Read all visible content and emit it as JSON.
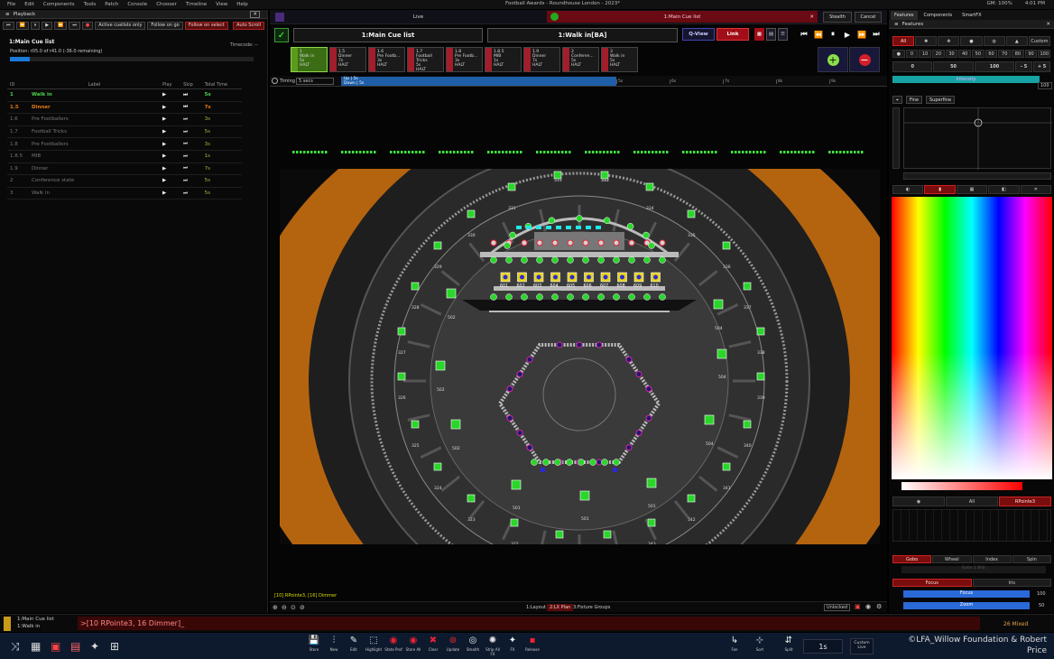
{
  "menu": {
    "items": [
      "File",
      "Edit",
      "Components",
      "Tools",
      "Patch",
      "Console",
      "Chooser",
      "Timeline",
      "View",
      "Help"
    ],
    "title": "Football Awards - Roundhouse London - 2023*",
    "gm": "GM: 100%",
    "time": "4:01 PM"
  },
  "playback": {
    "panel_title": "Playback",
    "buttons": {
      "active": "Active cuelists only",
      "follow_go": "Follow on go",
      "follow_select": "Follow on select",
      "auto_scroll": "Auto Scroll"
    },
    "cuelist_name": "1:Main Cue list",
    "timecode": "Timecode: --",
    "position": "Position: r05.0 of r41.0 (-36.0 remaining)",
    "progress": 0.08,
    "columns": [
      "ID",
      "Label",
      "Play",
      "Skip",
      "Total Time"
    ],
    "cues": [
      {
        "id": "1",
        "label": "Walk in",
        "time": "5s",
        "state": "active"
      },
      {
        "id": "1.5",
        "label": "Dinner",
        "time": "7s",
        "state": "next"
      },
      {
        "id": "1.6",
        "label": "Pre Footballers",
        "time": "3s",
        "state": ""
      },
      {
        "id": "1.7",
        "label": "Football Tricks",
        "time": "5s",
        "state": ""
      },
      {
        "id": "1.8",
        "label": "Pre Footballers",
        "time": "3s",
        "state": ""
      },
      {
        "id": "1.8.5",
        "label": "MIB",
        "time": "1s",
        "state": ""
      },
      {
        "id": "1.9",
        "label": "Dinner",
        "time": "7s",
        "state": ""
      },
      {
        "id": "2",
        "label": "Conference state",
        "time": "5s",
        "state": ""
      },
      {
        "id": "3",
        "label": "Walk in",
        "time": "5s",
        "state": ""
      }
    ]
  },
  "center": {
    "live": "Live",
    "current_cuelist": "1:Main Cue list",
    "stealth": "Stealth",
    "cancel": "Cancel",
    "cuelist_box": "1:Main Cue list",
    "walkin_box": "1:Walk in[BA]",
    "qview": "Q-View",
    "link": "Link",
    "tiles": [
      {
        "n": "1",
        "l": "Walk in",
        "t": "5s",
        "h": "HALT"
      },
      {
        "n": "1.5",
        "l": "Dinner",
        "t": "7s",
        "h": "HALT"
      },
      {
        "n": "1.6",
        "l": "Pre Footb...",
        "t": "3s",
        "h": "HALT"
      },
      {
        "n": "1.7",
        "l": "Football Tricks",
        "t": "5s",
        "h": "HALT"
      },
      {
        "n": "1.8",
        "l": "Pre Footb...",
        "t": "3s",
        "h": "HALT"
      },
      {
        "n": "1.8.5",
        "l": "MIB",
        "t": "1s",
        "h": "HALT"
      },
      {
        "n": "1.9",
        "l": "Dinner",
        "t": "7s",
        "h": "HALT"
      },
      {
        "n": "2",
        "l": "Conferen...",
        "t": "5s",
        "h": "HALT"
      },
      {
        "n": "3",
        "l": "Walk in",
        "t": "5s",
        "h": "HALT"
      }
    ],
    "timing": "Timing",
    "timing_val": "5 secs",
    "up": "Up | 5s",
    "down": "Down | 5s",
    "ticks": [
      "5s",
      "6s",
      "7s",
      "8s",
      "9s"
    ],
    "cmd_status": "[10] RPointe3, [16] Dimmer",
    "views": [
      "1:Layout",
      "2:LX Plan",
      "3:Fixture Groups"
    ],
    "unlocked": "Unlocked",
    "fixture_labels": [
      "333",
      "333",
      "333",
      "334",
      "335",
      "330",
      "331",
      "329",
      "336",
      "337",
      "328",
      "327",
      "338",
      "326",
      "339",
      "325",
      "340",
      "324",
      "341",
      "323",
      "342",
      "322",
      "343",
      "321",
      "344",
      "501",
      "501",
      "501",
      "502",
      "502",
      "502",
      "504",
      "504",
      "504",
      "601",
      "602",
      "603",
      "604",
      "605",
      "606",
      "607",
      "608",
      "609",
      "610"
    ]
  },
  "features": {
    "tabs": [
      "Features",
      "Components",
      "SmartFX"
    ],
    "title": "Features",
    "types": [
      "All",
      "",
      "",
      "",
      "",
      "",
      "Custom"
    ],
    "values": [
      "0",
      "10",
      "20",
      "30",
      "40",
      "50",
      "60",
      "70",
      "80",
      "90",
      "100"
    ],
    "presets": [
      "0",
      "50",
      "100",
      "- 5",
      "+ 5"
    ],
    "intensity": "Intensity",
    "intensity_val": "100",
    "fine": "Fine",
    "superfine": "Superfine",
    "cols": [
      "All",
      "RPointe3"
    ],
    "gobo_tabs": [
      "Gobo",
      "Wheel",
      "Index",
      "Spin"
    ],
    "gobo_btn": "Gobo 1 Bldr",
    "focus_tabs": [
      "Focus",
      "Iris"
    ],
    "focus": "Focus",
    "zoom": "Zoom",
    "focus_val": "100",
    "zoom_val": "50"
  },
  "cmdline": {
    "l1": "1:Main Cue list",
    "l2": "1:Walk in",
    "cmd": ">[10 RPointe3, 16 Dimmer]_",
    "mixed": "26 Mixed"
  },
  "toolbar": {
    "tools": [
      "Store",
      "New",
      "Edit",
      "Highlight",
      "State Prof",
      "Store All",
      "Clear",
      "Update",
      "Stealth",
      "Strip All FX",
      "FX",
      "Release"
    ],
    "fan": "Fan",
    "sort": "Sort",
    "split": "Split",
    "time": "1s",
    "custom": "Custom",
    "live": "Live",
    "copyright": "©LFA_Willow Foundation & Robert Price"
  }
}
